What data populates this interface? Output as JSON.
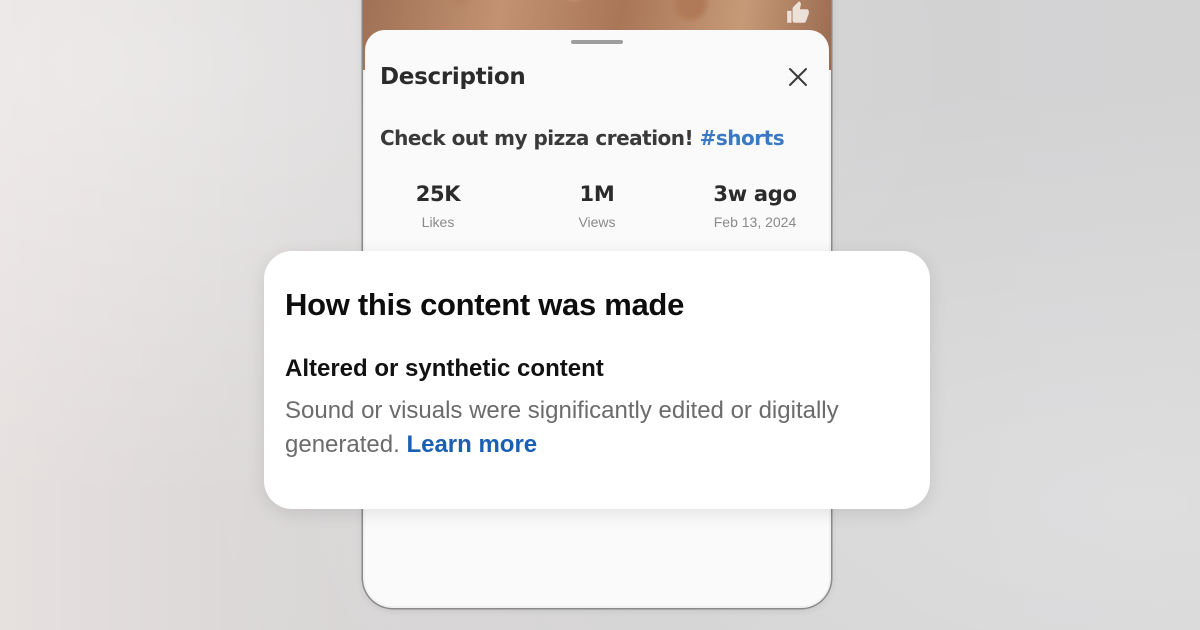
{
  "description_sheet": {
    "title": "Description",
    "caption_text": "Check out my pizza creation! ",
    "caption_hashtag": "#shorts",
    "stats": [
      {
        "value": "25K",
        "label": "Likes"
      },
      {
        "value": "1M",
        "label": "Views"
      },
      {
        "value": "3w ago",
        "label": "Feb 13, 2024"
      }
    ]
  },
  "content_info": {
    "title": "How this content was made",
    "subtitle": "Altered or synthetic content",
    "body": "Sound or visuals were significantly edited or digitally generated.",
    "link_label": "Learn more"
  },
  "icons": {
    "close": "close-icon",
    "like": "thumbs-up-icon"
  },
  "colors": {
    "hashtag": "#3a79c4",
    "link": "#1a5fb4"
  }
}
